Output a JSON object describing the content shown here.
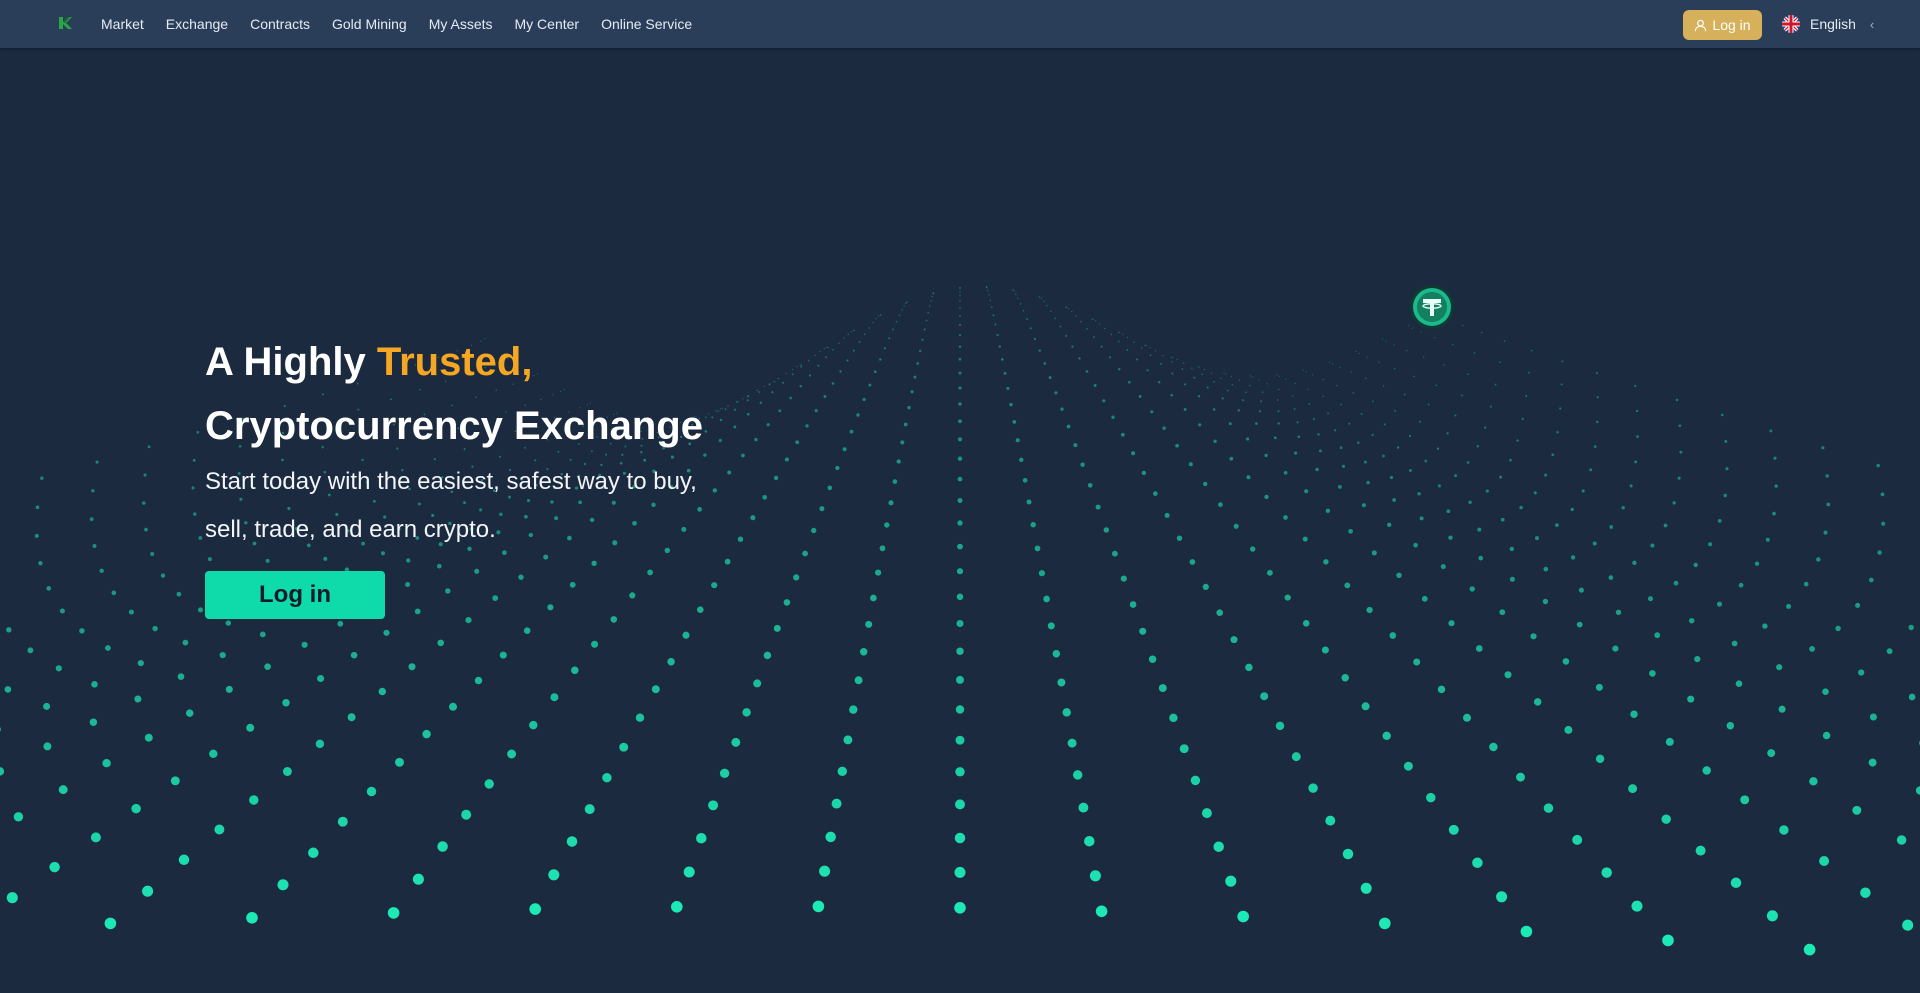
{
  "nav": {
    "items": [
      {
        "label": "Market"
      },
      {
        "label": "Exchange"
      },
      {
        "label": "Contracts"
      },
      {
        "label": "Gold Mining"
      },
      {
        "label": "My Assets"
      },
      {
        "label": "My Center"
      },
      {
        "label": "Online Service"
      }
    ],
    "login_label": "Log in",
    "language_label": "English",
    "icons": {
      "logo": "brand-logo-icon",
      "login": "user-icon",
      "language": "uk-flag-icon",
      "chevron": "chevron-left-icon"
    }
  },
  "hero": {
    "title_part1": "A Highly ",
    "title_accent": "Trusted,",
    "title_line2": "Cryptocurrency Exchange",
    "subtitle_line1": "Start today with the easiest, safest way to buy,",
    "subtitle_line2": "sell, trade, and earn crypto.",
    "login_button": "Log in"
  },
  "colors": {
    "background": "#1b2a3f",
    "navbar": "#2a3e5a",
    "accent": "#f5a623",
    "primary_button": "#0fdbaa",
    "nav_login_button": "#d6b05a",
    "dots": "#1de9b6"
  }
}
